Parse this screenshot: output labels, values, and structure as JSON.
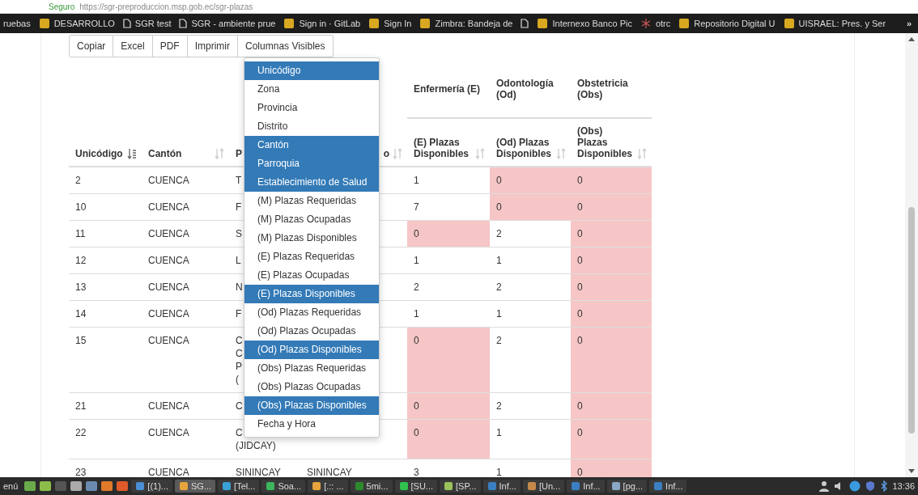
{
  "address_bar": {
    "secure_label": "Seguro",
    "url": "https://sgr-preproduccion.msp.gob.ec/sgr-plazas"
  },
  "bookmarks": [
    {
      "label": "ruebas",
      "kind": "none"
    },
    {
      "label": "DESARROLLO",
      "kind": "app"
    },
    {
      "label": "SGR test",
      "kind": "page"
    },
    {
      "label": "SGR - ambiente prue",
      "kind": "page"
    },
    {
      "label": "Sign in · GitLab",
      "kind": "app"
    },
    {
      "label": "Sign In",
      "kind": "app"
    },
    {
      "label": "Zimbra: Bandeja de",
      "kind": "app"
    },
    {
      "kind": "page"
    },
    {
      "label": "Internexo Banco Pic",
      "kind": "app"
    },
    {
      "label": "otrc",
      "kind": "star"
    },
    {
      "label": "Repositorio Digital U",
      "kind": "app"
    },
    {
      "label": "UISRAEL: Pres. y Ser",
      "kind": "app"
    }
  ],
  "more_bookmarks": "»",
  "toolbar_buttons": [
    "Copiar",
    "Excel",
    "PDF",
    "Imprimir",
    "Columnas Visibles"
  ],
  "table": {
    "group_headers": [
      "Enfermería (E)",
      "Odontología (Od)",
      "Obstetricia (Obs)"
    ],
    "columns": [
      {
        "label": "Unicódigo",
        "sorted": true
      },
      {
        "label": "Cantón",
        "sorted": false
      },
      {
        "label": "P"
      },
      {
        "label": "o",
        "sorted": false
      },
      {
        "label": "(E) Plazas Disponibles",
        "sorted": false
      },
      {
        "label": "(Od) Plazas Disponibles",
        "sorted": false
      },
      {
        "label": "(Obs) Plazas Disponibles",
        "sorted": false
      }
    ],
    "rows": [
      {
        "unicodigo": "2",
        "canton": "CUENCA",
        "col3": [
          "T"
        ],
        "col4": "",
        "values": [
          {
            "v": "1",
            "alert": false
          },
          {
            "v": "0",
            "alert": true
          },
          {
            "v": "0",
            "alert": true
          }
        ]
      },
      {
        "unicodigo": "10",
        "canton": "CUENCA",
        "col3": [
          "F"
        ],
        "col4": "",
        "values": [
          {
            "v": "7",
            "alert": false
          },
          {
            "v": "0",
            "alert": true
          },
          {
            "v": "0",
            "alert": true
          }
        ]
      },
      {
        "unicodigo": "11",
        "canton": "CUENCA",
        "col3": [
          "S"
        ],
        "col4": "",
        "values": [
          {
            "v": "0",
            "alert": true
          },
          {
            "v": "2",
            "alert": false
          },
          {
            "v": "0",
            "alert": true
          }
        ]
      },
      {
        "unicodigo": "12",
        "canton": "CUENCA",
        "col3": [
          "L"
        ],
        "col4": "",
        "values": [
          {
            "v": "1",
            "alert": false
          },
          {
            "v": "1",
            "alert": false
          },
          {
            "v": "0",
            "alert": true
          }
        ]
      },
      {
        "unicodigo": "13",
        "canton": "CUENCA",
        "col3": [
          "N"
        ],
        "col4": "",
        "values": [
          {
            "v": "2",
            "alert": false
          },
          {
            "v": "2",
            "alert": false
          },
          {
            "v": "0",
            "alert": true
          }
        ]
      },
      {
        "unicodigo": "14",
        "canton": "CUENCA",
        "col3": [
          "F"
        ],
        "col4": "",
        "values": [
          {
            "v": "1",
            "alert": false
          },
          {
            "v": "1",
            "alert": false
          },
          {
            "v": "0",
            "alert": true
          }
        ]
      },
      {
        "unicodigo": "15",
        "canton": "CUENCA",
        "col3": [
          "C",
          "C",
          "P",
          "("
        ],
        "col4": "",
        "values": [
          {
            "v": "0",
            "alert": true
          },
          {
            "v": "2",
            "alert": false
          },
          {
            "v": "0",
            "alert": true
          }
        ]
      },
      {
        "unicodigo": "21",
        "canton": "CUENCA",
        "col3": [
          "C"
        ],
        "col4": "",
        "values": [
          {
            "v": "0",
            "alert": true
          },
          {
            "v": "2",
            "alert": false
          },
          {
            "v": "0",
            "alert": true
          }
        ]
      },
      {
        "unicodigo": "22",
        "canton": "CUENCA",
        "col3": [
          "C",
          "(JIDCAY)"
        ],
        "col4": "",
        "values": [
          {
            "v": "0",
            "alert": true
          },
          {
            "v": "1",
            "alert": false
          },
          {
            "v": "0",
            "alert": true
          }
        ]
      },
      {
        "unicodigo": "23",
        "canton": "CUENCA",
        "col3": [
          "SININCAY"
        ],
        "col4": "SININCAY",
        "values": [
          {
            "v": "3",
            "alert": false
          },
          {
            "v": "1",
            "alert": false
          },
          {
            "v": "0",
            "alert": true
          }
        ]
      }
    ]
  },
  "column_menu": [
    {
      "label": "Unicódigo",
      "selected": true
    },
    {
      "label": "Zona",
      "selected": false
    },
    {
      "label": "Provincia",
      "selected": false
    },
    {
      "label": "Distrito",
      "selected": false
    },
    {
      "label": "Cantón",
      "selected": true
    },
    {
      "label": "Parroquia",
      "selected": true
    },
    {
      "label": "Establecimiento de Salud",
      "selected": true
    },
    {
      "label": "(M) Plazas Requeridas",
      "selected": false
    },
    {
      "label": "(M) Plazas Ocupadas",
      "selected": false
    },
    {
      "label": "(M) Plazas Disponibles",
      "selected": false
    },
    {
      "label": "(E) Plazas Requeridas",
      "selected": false
    },
    {
      "label": "(E) Plazas Ocupadas",
      "selected": false
    },
    {
      "label": "(E) Plazas Disponibles",
      "selected": true
    },
    {
      "label": "(Od) Plazas Requeridas",
      "selected": false
    },
    {
      "label": "(Od) Plazas Ocupadas",
      "selected": false
    },
    {
      "label": "(Od) Plazas Disponibles",
      "selected": true
    },
    {
      "label": "(Obs) Plazas Requeridas",
      "selected": false
    },
    {
      "label": "(Obs) Plazas Ocupadas",
      "selected": false
    },
    {
      "label": "(Obs) Plazas Disponibles",
      "selected": true
    },
    {
      "label": "Fecha y Hora",
      "selected": false
    }
  ],
  "taskbar": {
    "menu_label": "enú",
    "windows": [
      {
        "label": "[(1)...",
        "active": false
      },
      {
        "label": "SG...",
        "active": true
      },
      {
        "label": "[Tel...",
        "active": false
      },
      {
        "label": "Soa...",
        "active": false
      },
      {
        "label": "[.:: ...",
        "active": false
      },
      {
        "label": "5mi...",
        "active": false
      },
      {
        "label": "[SU...",
        "active": false
      },
      {
        "label": "[SP...",
        "active": false
      },
      {
        "label": "Inf...",
        "active": false
      },
      {
        "label": "[Un...",
        "active": false
      },
      {
        "label": "Inf...",
        "active": false
      },
      {
        "label": "[pg...",
        "active": false
      },
      {
        "label": "Inf...",
        "active": false
      }
    ],
    "clock": "13:36"
  }
}
